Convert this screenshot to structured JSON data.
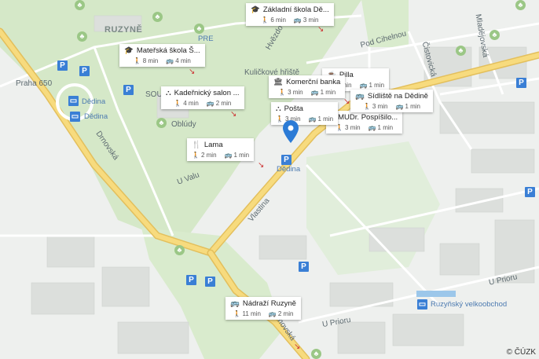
{
  "map": {
    "district": "RUZYNĚ",
    "copyright": "© ČÚZK",
    "streets": [
      "Praha 650",
      "Drnovská",
      "U Valu",
      "Vlastina",
      "Pod Cihelnou",
      "Čistovická",
      "Mladějovská",
      "Kuličkové hřiště",
      "Hvězdova",
      "Oblúdy",
      "U Prioru",
      "U Prioru",
      "Drnovská",
      "SOU",
      "PRE",
      "Ruzyňský velkoobchod"
    ],
    "poi_labels": [
      "Dědina",
      "Dědina",
      "Dědina"
    ],
    "cards": [
      {
        "title": "Základní škola Dě...",
        "icon": "school-icon",
        "walk": "6 min",
        "transit": "3 min"
      },
      {
        "title": "Mateřská škola Š...",
        "icon": "school-icon",
        "walk": "8 min",
        "transit": "4 min"
      },
      {
        "title": "Kadeřnický salon ...",
        "icon": "salon-icon",
        "walk": "4 min",
        "transit": "2 min"
      },
      {
        "title": "Komerční banka",
        "icon": "bank-icon",
        "walk": "3 min",
        "transit": "1 min"
      },
      {
        "title": "Pošta",
        "icon": "post-icon",
        "walk": "3 min",
        "transit": "1 min"
      },
      {
        "title": "Lama",
        "icon": "restaurant-icon",
        "walk": "2 min",
        "transit": "1 min"
      },
      {
        "title": "Pilla",
        "icon": "bakery-icon",
        "walk": "2 min",
        "transit": "1 min"
      },
      {
        "title": "Sídliště na Dědině",
        "icon": "bus-icon",
        "walk": "3 min",
        "transit": "1 min"
      },
      {
        "title": "MUDr. Pospíšilo...",
        "icon": "doctor-icon",
        "walk": "3 min",
        "transit": "1 min"
      },
      {
        "title": "Nádraží Ruzyně",
        "icon": "bus-icon",
        "walk": "11 min",
        "transit": "2 min"
      }
    ]
  },
  "colors": {
    "road": "#f4d77a",
    "road_border": "#e7c25e",
    "green": "#c9e2b8",
    "building": "#d9dcd9",
    "water": "#9cc7ea",
    "pin": "#2b7bd6",
    "parking": "#3a7fd5"
  }
}
